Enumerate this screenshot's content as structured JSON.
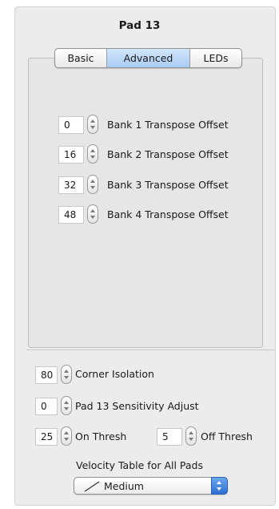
{
  "panel": {
    "title": "Pad 13"
  },
  "tabs": [
    {
      "label": "Basic",
      "selected": false
    },
    {
      "label": "Advanced",
      "selected": true
    },
    {
      "label": "LEDs",
      "selected": false
    }
  ],
  "transpose": [
    {
      "value": "0",
      "label": "Bank 1 Transpose Offset"
    },
    {
      "value": "16",
      "label": "Bank 2 Transpose Offset"
    },
    {
      "value": "32",
      "label": "Bank 3 Transpose Offset"
    },
    {
      "value": "48",
      "label": "Bank 4 Transpose Offset"
    }
  ],
  "corner": {
    "value": "80",
    "label": "Corner Isolation"
  },
  "sensitivity": {
    "value": "0",
    "label": "Pad 13 Sensitivity Adjust"
  },
  "on_thresh": {
    "value": "25",
    "label": "On Thresh"
  },
  "off_thresh": {
    "value": "5",
    "label": "Off Thresh"
  },
  "velocity": {
    "label": "Velocity Table for All Pads",
    "selected": "Medium",
    "icon": "curve-icon"
  },
  "colors": {
    "panel_bg": "#ececec",
    "selected_tab": "#a7cbf3",
    "popup_arrow": "#2f6fd1"
  }
}
